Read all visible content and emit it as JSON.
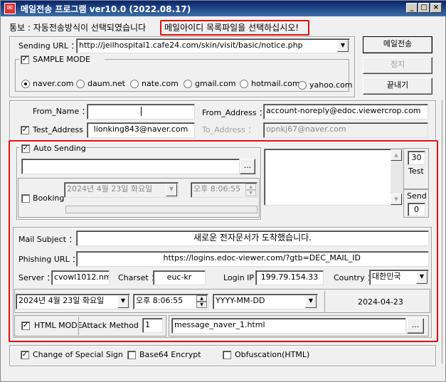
{
  "window": {
    "title": "메일전송 프로그램 ver10.0 (2022.08.17)",
    "min": "_",
    "max": "□",
    "close": "×",
    "app_icon": "envelope-icon"
  },
  "notice": {
    "prefix": "통보 : 자동전송방식이 선택되였습니다",
    "highlight": "메일아이디 목록파일을 선택하십시오!"
  },
  "sending_url": {
    "label": "Sending URL ：",
    "value": "http://jeilhospital1.cafe24.com/skin/visit/basic/notice.php"
  },
  "sample_mode": {
    "label": "SAMPLE MODE",
    "checked": true,
    "options": [
      "naver.com",
      "daum.net",
      "nate.com",
      "gmail.com",
      "hotmail.com",
      "yahoo.com"
    ],
    "selected": "naver.com"
  },
  "buttons": {
    "send": "메일전송",
    "stop": "정지",
    "exit": "끝내기",
    "browse": "...",
    "file_browse": "..."
  },
  "from": {
    "name_label": "From_Name ：",
    "name_value": "",
    "address_label": "From_Address ：",
    "address_value": "account-noreply@edoc.viewercrop.com"
  },
  "test": {
    "label": "Test_Address ：",
    "checked": true,
    "value": "lionking843@naver.com",
    "to_label": "To_Address ：",
    "to_value": "opnkj67@naver.com"
  },
  "auto": {
    "label": "Auto Sending",
    "checked": true,
    "path": "",
    "count": "30",
    "test_label": "Test",
    "send_label": "Send",
    "send_count": "0"
  },
  "booking": {
    "label": "Booking",
    "checked": false,
    "date": "2024년   4월 23일 화요일",
    "time": "오후   8:06:55"
  },
  "mail": {
    "subject_label": "Mail Subject ：",
    "subject": "새로운 전자문서가 도착했습니다.",
    "phishing_label": "Phishing URL ：",
    "phishing": "https://logins.edoc-viewer.com/?gtb=DEC_MAIL_ID",
    "server_label": "Server ：",
    "server": "cvowl1012.nm",
    "charset_label": "Charset ：",
    "charset": "euc-kr",
    "loginip_label": "Login IP ：",
    "loginip": "199.79.154.33",
    "country_label": "Country ：",
    "country": "대한민국",
    "date": "2024년   4월 23일 화요일",
    "time": "오후   8:06:55",
    "format": "YYYY-MM-DD",
    "formatted_date": "2024-04-23",
    "html_mode_label": "HTML MODE",
    "html_mode": true,
    "attack_label": "Attack Method ：",
    "attack": "1",
    "message_file": "message_naver_1.html"
  },
  "options": {
    "special_sign": "Change of Special Sign",
    "special_sign_checked": true,
    "base64": "Base64 Encrypt",
    "base64_checked": false,
    "obfuscation": "Obfuscation(HTML)",
    "obfuscation_checked": false
  },
  "colors": {
    "highlight_border": "#e01010",
    "titlebar": "#0a246a"
  }
}
